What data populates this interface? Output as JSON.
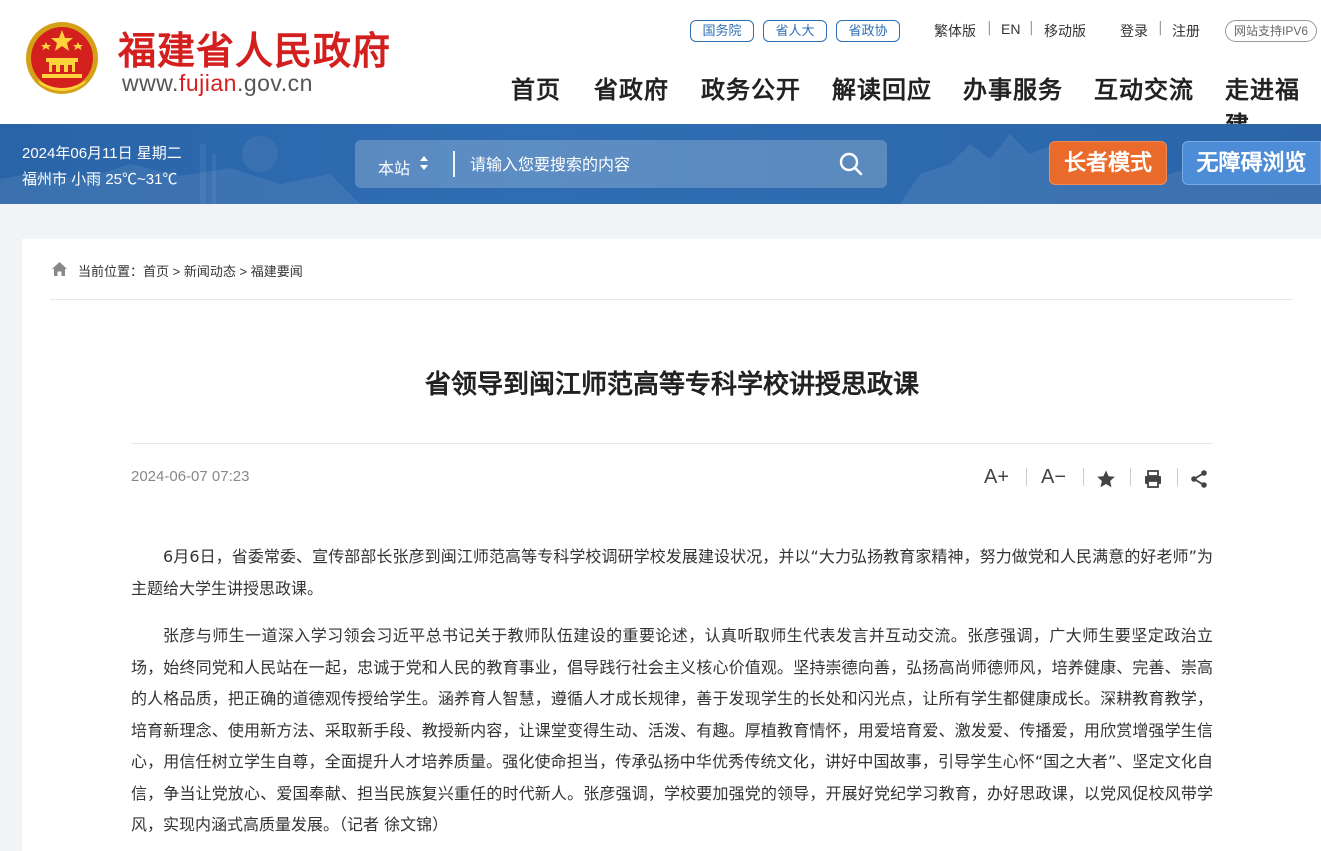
{
  "header": {
    "site_name": "福建省人民政府",
    "site_url_prefix": "www.",
    "site_url_highlight": "fujian",
    "site_url_suffix": ".gov.cn",
    "pills": [
      "国务院",
      "省人大",
      "省政协"
    ],
    "lang_links": [
      "繁体版",
      "EN",
      "移动版"
    ],
    "auth_links": [
      "登录",
      "注册"
    ],
    "ipv6": "网站支持IPV6",
    "nav": [
      "首页",
      "省政府",
      "政务公开",
      "解读回应",
      "办事服务",
      "互动交流",
      "走进福建"
    ]
  },
  "banner": {
    "date": "2024年06月11日 星期二",
    "weather": "福州市 小雨 25℃~31℃",
    "search_scope": "本站",
    "search_placeholder": "请输入您要搜索的内容",
    "elder_mode": "长者模式",
    "accessible": "无障碍浏览"
  },
  "breadcrumb": {
    "label": "当前位置：",
    "items": [
      "首页",
      "新闻动态",
      "福建要闻"
    ],
    "separator": ">"
  },
  "article": {
    "title": "省领导到闽江师范高等专科学校讲授思政课",
    "date": "2024-06-07 07:23",
    "tools": {
      "font_up": "A+",
      "font_down": "A−"
    },
    "paragraphs": [
      "6月6日，省委常委、宣传部部长张彦到闽江师范高等专科学校调研学校发展建设状况，并以“大力弘扬教育家精神，努力做党和人民满意的好老师”为主题给大学生讲授思政课。",
      "张彦与师生一道深入学习领会习近平总书记关于教师队伍建设的重要论述，认真听取师生代表发言并互动交流。张彦强调，广大师生要坚定政治立场，始终同党和人民站在一起，忠诚于党和人民的教育事业，倡导践行社会主义核心价值观。坚持崇德向善，弘扬高尚师德师风，培养健康、完善、崇高的人格品质，把正确的道德观传授给学生。涵养育人智慧，遵循人才成长规律，善于发现学生的长处和闪光点，让所有学生都健康成长。深耕教育教学，培育新理念、使用新方法、采取新手段、教授新内容，让课堂变得生动、活泼、有趣。厚植教育情怀，用爱培育爱、激发爱、传播爱，用欣赏增强学生信心，用信任树立学生自尊，全面提升人才培养质量。强化使命担当，传承弘扬中华优秀传统文化，讲好中国故事，引导学生心怀“国之大者”、坚定文化自信，争当让党放心、爱国奉献、担当民族复兴重任的时代新人。张彦强调，学校要加强党的领导，开展好党纪学习教育，办好思政课，以党风促校风带学风，实现内涵式高质量发展。（记者  徐文锦）"
    ]
  },
  "colors": {
    "brand_red": "#d41f1f",
    "banner_blue": "#2d69ad",
    "elder_orange": "#e96a2a",
    "accessible_blue": "#4d8cd6",
    "pill_blue": "#2e6eb5"
  },
  "icons": [
    "national-emblem-icon",
    "chevron-updown-icon",
    "search-icon",
    "home-icon",
    "star-icon",
    "print-icon",
    "share-icon"
  ]
}
